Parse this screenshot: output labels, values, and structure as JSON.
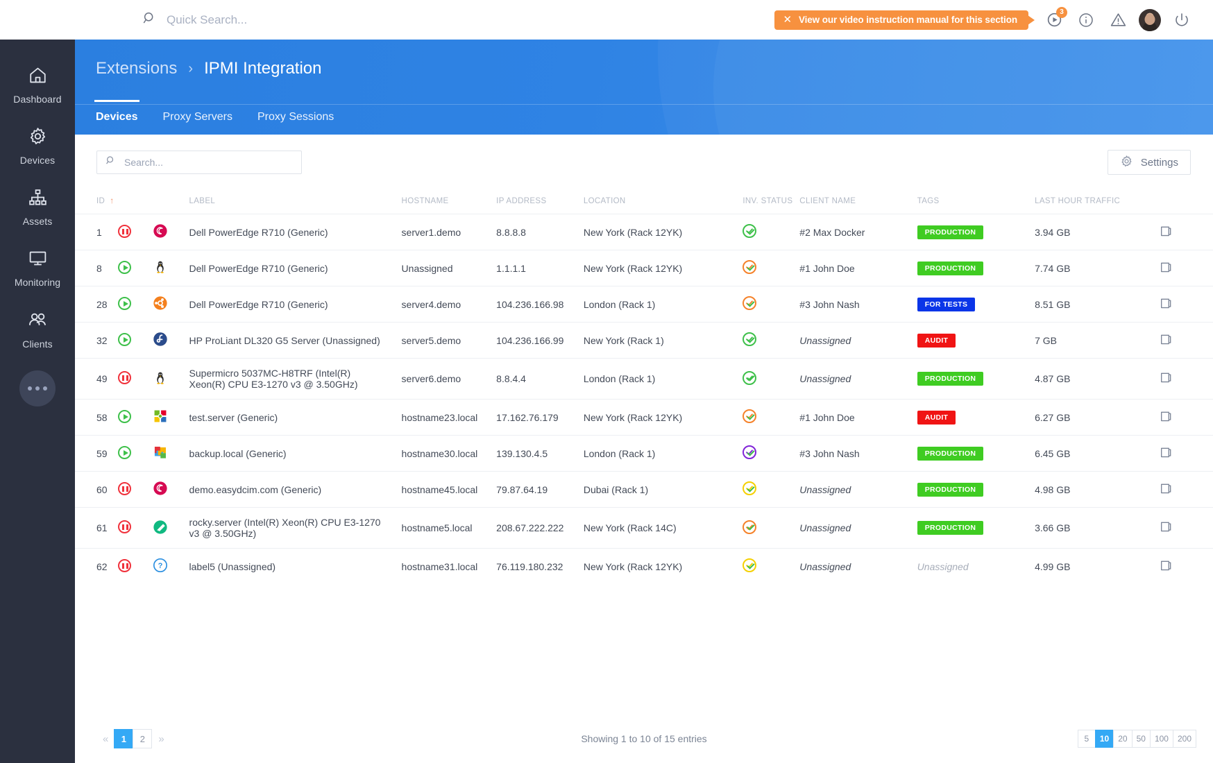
{
  "topbar": {
    "quick_search_placeholder": "Quick Search...",
    "search_icon": "search-icon",
    "video_banner": {
      "close_label": "✕",
      "text": "View our video instruction manual for this section"
    },
    "video_badge": "3",
    "icons": [
      "video-play-icon",
      "info-icon",
      "warning-icon",
      "avatar",
      "power-icon"
    ]
  },
  "sidebar": {
    "items": [
      {
        "label": "Dashboard",
        "icon": "home-icon"
      },
      {
        "label": "Devices",
        "icon": "gear-icon"
      },
      {
        "label": "Assets",
        "icon": "sitemap-icon"
      },
      {
        "label": "Monitoring",
        "icon": "monitor-icon"
      },
      {
        "label": "Clients",
        "icon": "users-icon"
      }
    ],
    "more_label": "more-icon"
  },
  "header": {
    "breadcrumb_parent": "Extensions",
    "breadcrumb_sep": "›",
    "breadcrumb_current": "IPMI Integration",
    "tabs": [
      {
        "label": "Devices",
        "active": true
      },
      {
        "label": "Proxy Servers",
        "active": false
      },
      {
        "label": "Proxy Sessions",
        "active": false
      }
    ]
  },
  "toolbar": {
    "search_placeholder": "Search...",
    "search_value": "",
    "settings_label": "Settings",
    "settings_icon": "gear-icon"
  },
  "table": {
    "columns": [
      "ID",
      "",
      "",
      "LABEL",
      "HOSTNAME",
      "IP ADDRESS",
      "LOCATION",
      "INV. STATUS",
      "CLIENT NAME",
      "TAGS",
      "LAST HOUR TRAFFIC",
      ""
    ],
    "sorted_column": "ID",
    "sort_direction": "asc",
    "sort_arrow": "↑",
    "rows": [
      {
        "id": "1",
        "power": "stopped",
        "os": "debian",
        "label": "Dell PowerEdge R710 (Generic)",
        "hostname": "server1.demo",
        "ip": "8.8.8.8",
        "location": "New York (Rack 12YK)",
        "inv_color": "#3ec04a",
        "client": "#2 Max Docker",
        "client_unassigned": false,
        "tag": "PRODUCTION",
        "tag_color": "#3fcc22",
        "traffic": "3.94 GB"
      },
      {
        "id": "8",
        "power": "running",
        "os": "tux",
        "label": "Dell PowerEdge R710 (Generic)",
        "hostname": "Unassigned",
        "ip": "1.1.1.1",
        "location": "New York (Rack 12YK)",
        "inv_color": "#f5822a",
        "client": "#1 John Doe",
        "client_unassigned": false,
        "tag": "PRODUCTION",
        "tag_color": "#3fcc22",
        "traffic": "7.74 GB"
      },
      {
        "id": "28",
        "power": "running",
        "os": "ubuntu",
        "label": "Dell PowerEdge R710 (Generic)",
        "hostname": "server4.demo",
        "ip": "104.236.166.98",
        "location": "London (Rack 1)",
        "inv_color": "#f5822a",
        "client": "#3 John Nash",
        "client_unassigned": false,
        "tag": "FOR TESTS",
        "tag_color": "#0b35e8",
        "traffic": "8.51 GB"
      },
      {
        "id": "32",
        "power": "running",
        "os": "fedora",
        "label": "HP ProLiant DL320 G5 Server (Unassigned)",
        "hostname": "server5.demo",
        "ip": "104.236.166.99",
        "location": "New York (Rack 1)",
        "inv_color": "#3ec04a",
        "client": "Unassigned",
        "client_unassigned": true,
        "tag": "AUDIT",
        "tag_color": "#f01414",
        "traffic": "7 GB"
      },
      {
        "id": "49",
        "power": "stopped",
        "os": "tux",
        "label": "Supermicro 5037MC-H8TRF (Intel(R) Xeon(R) CPU E3-1270 v3 @ 3.50GHz)",
        "hostname": "server6.demo",
        "ip": "8.8.4.4",
        "location": "London (Rack 1)",
        "inv_color": "#3ec04a",
        "client": "Unassigned",
        "client_unassigned": true,
        "tag": "PRODUCTION",
        "tag_color": "#3fcc22",
        "traffic": "4.87 GB"
      },
      {
        "id": "58",
        "power": "running",
        "os": "opensuse",
        "label": "test.server (Generic)",
        "hostname": "hostname23.local",
        "ip": "17.162.76.179",
        "location": "New York (Rack 12YK)",
        "inv_color": "#f5822a",
        "client": "#1 John Doe",
        "client_unassigned": false,
        "tag": "AUDIT",
        "tag_color": "#f01414",
        "traffic": "6.27 GB"
      },
      {
        "id": "59",
        "power": "running",
        "os": "puzzle",
        "label": "backup.local (Generic)",
        "hostname": "hostname30.local",
        "ip": "139.130.4.5",
        "location": "London (Rack 1)",
        "inv_color": "#8124d8",
        "client": "#3 John Nash",
        "client_unassigned": false,
        "tag": "PRODUCTION",
        "tag_color": "#3fcc22",
        "traffic": "6.45 GB"
      },
      {
        "id": "60",
        "power": "stopped",
        "os": "debian",
        "label": "demo.easydcim.com (Generic)",
        "hostname": "hostname45.local",
        "ip": "79.87.64.19",
        "location": "Dubai (Rack 1)",
        "inv_color": "#f5d000",
        "client": "Unassigned",
        "client_unassigned": true,
        "tag": "PRODUCTION",
        "tag_color": "#3fcc22",
        "traffic": "4.98 GB"
      },
      {
        "id": "61",
        "power": "stopped",
        "os": "rocky",
        "label": "rocky.server (Intel(R) Xeon(R) CPU E3-1270 v3 @ 3.50GHz)",
        "hostname": "hostname5.local",
        "ip": "208.67.222.222",
        "location": "New York (Rack 14C)",
        "inv_color": "#f5822a",
        "client": "Unassigned",
        "client_unassigned": true,
        "tag": "PRODUCTION",
        "tag_color": "#3fcc22",
        "traffic": "3.66 GB"
      },
      {
        "id": "62",
        "power": "stopped",
        "os": "unknown",
        "label": "label5 (Unassigned)",
        "hostname": "hostname31.local",
        "ip": "76.119.180.232",
        "location": "New York (Rack 12YK)",
        "inv_color": "#f5d000",
        "client": "Unassigned",
        "client_unassigned": true,
        "tag": "Unassigned",
        "tag_color": "",
        "traffic": "4.99 GB"
      }
    ]
  },
  "footer": {
    "prev_label": "«",
    "next_label": "»",
    "pages": [
      "1",
      "2"
    ],
    "active_page": "1",
    "showing": "Showing 1 to 10 of 15 entries",
    "page_sizes": [
      "5",
      "10",
      "20",
      "50",
      "100",
      "200"
    ],
    "active_page_size": "10"
  }
}
